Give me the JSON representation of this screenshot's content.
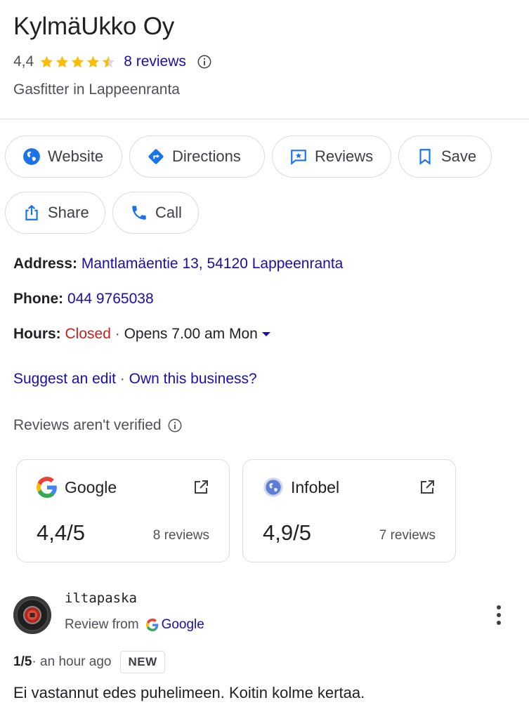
{
  "business": {
    "name": "KylmäUkko Oy",
    "rating": "4,4",
    "stars_value": 4.4,
    "reviews_link": "8 reviews",
    "category": "Gasfitter in Lappeenranta"
  },
  "actions": {
    "website": "Website",
    "directions": "Directions",
    "reviews": "Reviews",
    "save": "Save",
    "share": "Share",
    "call": "Call"
  },
  "details": {
    "address_label": "Address:",
    "address_value": "Mantlamäentie 13, 54120 Lappeenranta",
    "phone_label": "Phone:",
    "phone_value": "044 9765038",
    "hours_label": "Hours:",
    "hours_status": "Closed",
    "hours_separator": " · ",
    "hours_next": "Opens 7.00 am Mon"
  },
  "links": {
    "suggest_edit": "Suggest an edit",
    "separator": " · ",
    "own_business": "Own this business?"
  },
  "verified_note": "Reviews aren't verified",
  "sources": [
    {
      "name": "Google",
      "score": "4,4/5",
      "count": "8 reviews"
    },
    {
      "name": "Infobel",
      "score": "4,9/5",
      "count": "7 reviews"
    }
  ],
  "review": {
    "author": "iltapaska",
    "from_label": "Review from",
    "from_source": "Google",
    "score": "1/5",
    "time": " · an hour ago",
    "badge": "NEW",
    "text": "Ei vastannut edes puhelimeen. Koitin kolme kertaa."
  },
  "colors": {
    "link_blue": "#1a0dab",
    "closed_red": "#c5221f",
    "star_yellow": "#fbbc04",
    "action_blue": "#1a73e8"
  }
}
